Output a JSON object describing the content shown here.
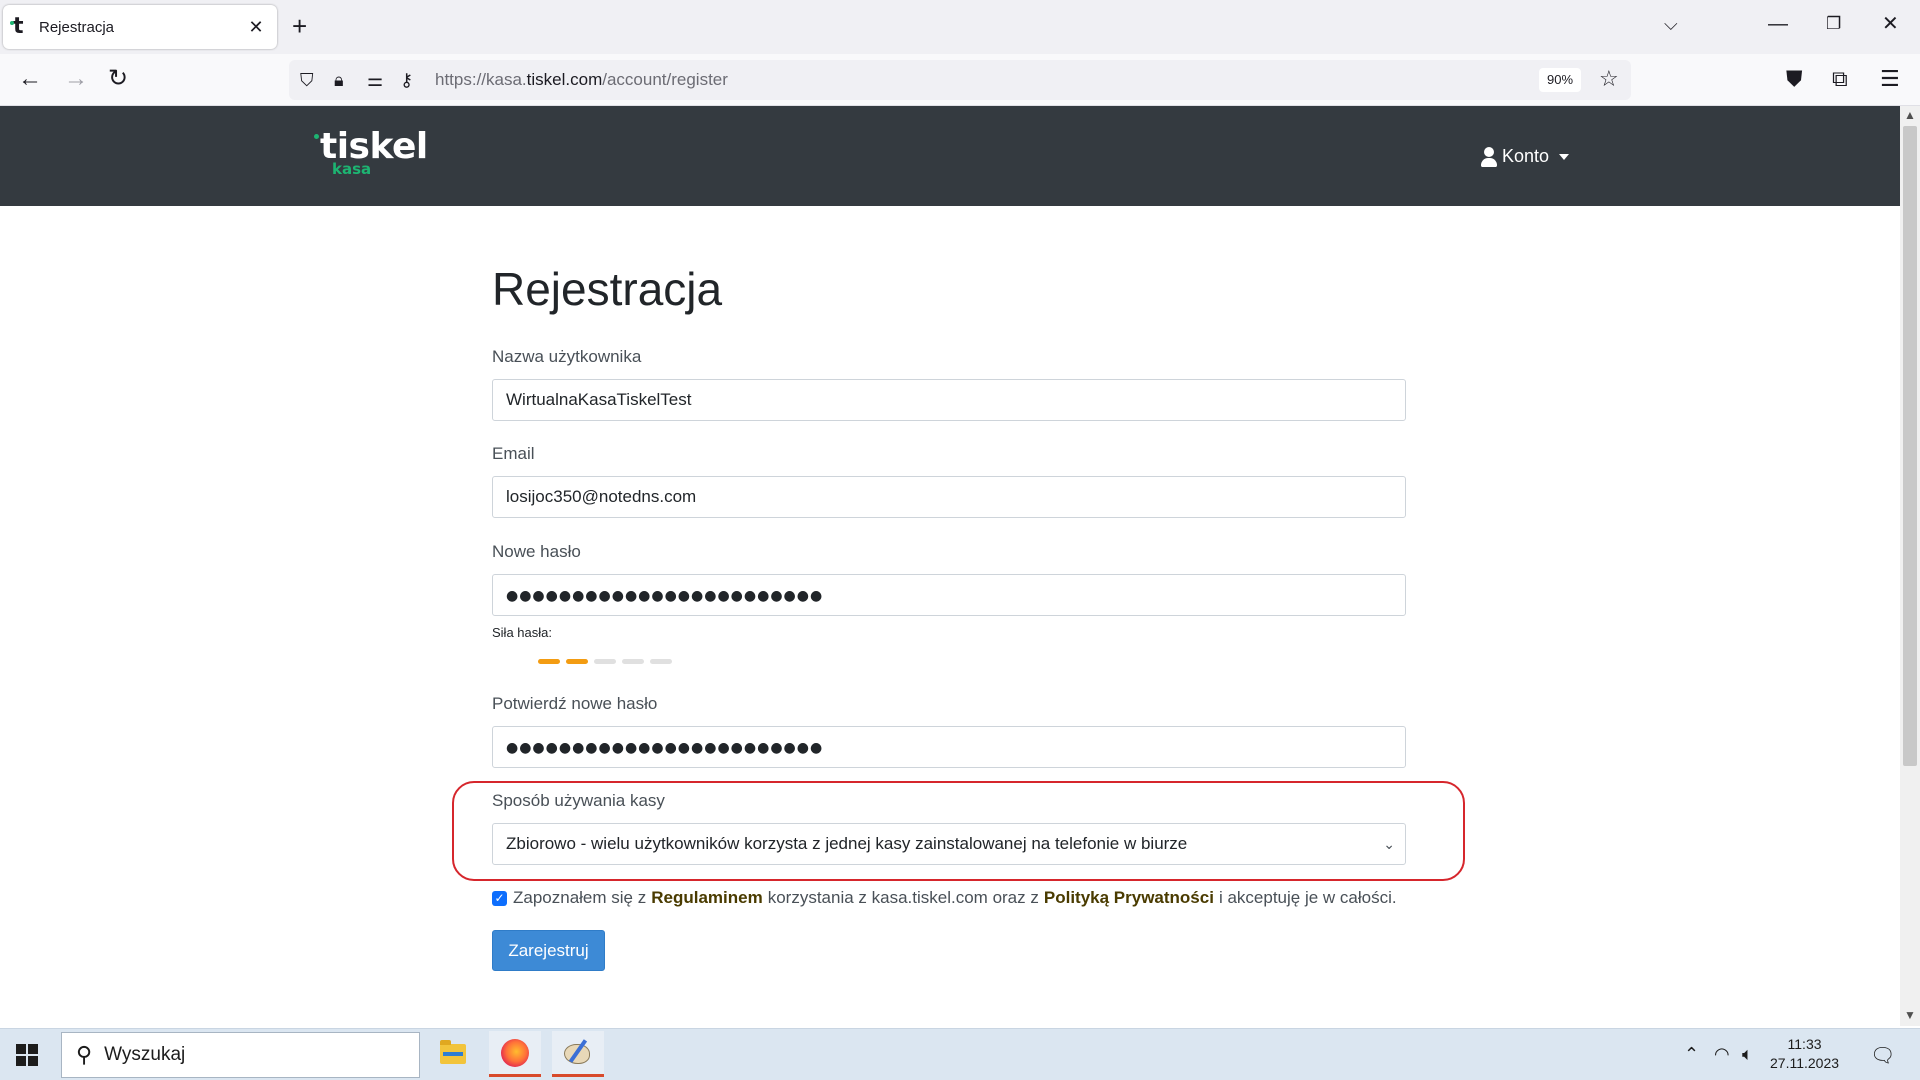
{
  "browser": {
    "tab": {
      "title": "Rejestracja",
      "close": "✕"
    },
    "new_tab": "+",
    "tabs_menu": "⌵",
    "window": {
      "minimize": "—",
      "restore": "❐",
      "close": "✕"
    },
    "nav": {
      "back": "←",
      "forward": "→",
      "reload": "↻"
    },
    "url": {
      "prefix": "https://kasa.",
      "host": "tiskel.com",
      "path": "/account/register"
    },
    "zoom": "90%",
    "icons": [
      "shield-icon",
      "lock-icon",
      "permissions-icon",
      "key-icon",
      "bookmark-star-icon",
      "pocket-icon",
      "extensions-icon",
      "menu-icon"
    ]
  },
  "site": {
    "logo": {
      "main": "tiskel",
      "sub": "kasa"
    },
    "account_label": "Konto",
    "colors": {
      "header_bg": "#343a40",
      "brand_green": "#1db472"
    }
  },
  "form": {
    "title": "Rejestracja",
    "username": {
      "label": "Nazwa użytkownika",
      "value": "WirtualnaKasaTiskelTest"
    },
    "email": {
      "label": "Email",
      "value": "losijoc350@notedns.com"
    },
    "password": {
      "label": "Nowe hasło",
      "value": "●●●●●●●●●●●●●●●●●●●●●●●●"
    },
    "strength": {
      "label": "Siła hasła:",
      "level": 2,
      "max": 5,
      "color": "#f39c12"
    },
    "confirm": {
      "label": "Potwierdź nowe hasło",
      "value": "●●●●●●●●●●●●●●●●●●●●●●●●"
    },
    "usage": {
      "label": "Sposób używania kasy",
      "selected": "Zbiorowo - wielu użytkowników korzysta z jednej kasy zainstalowanej na telefonie w biurze",
      "highlight_color": "#d6262c"
    },
    "terms": {
      "checked": true,
      "part1": "Zapoznałem się z",
      "link1": "Regulaminem",
      "part2": "korzystania z kasa.tiskel.com oraz z",
      "link2": "Polityką Prywatności",
      "part3": "i akceptuję je w całości."
    },
    "submit": "Zarejestruj"
  },
  "taskbar": {
    "search_placeholder": "Wyszukaj",
    "apps": [
      "file-explorer-icon",
      "firefox-icon",
      "paint-icon"
    ],
    "time": "11:33",
    "date": "27.11.2023"
  }
}
